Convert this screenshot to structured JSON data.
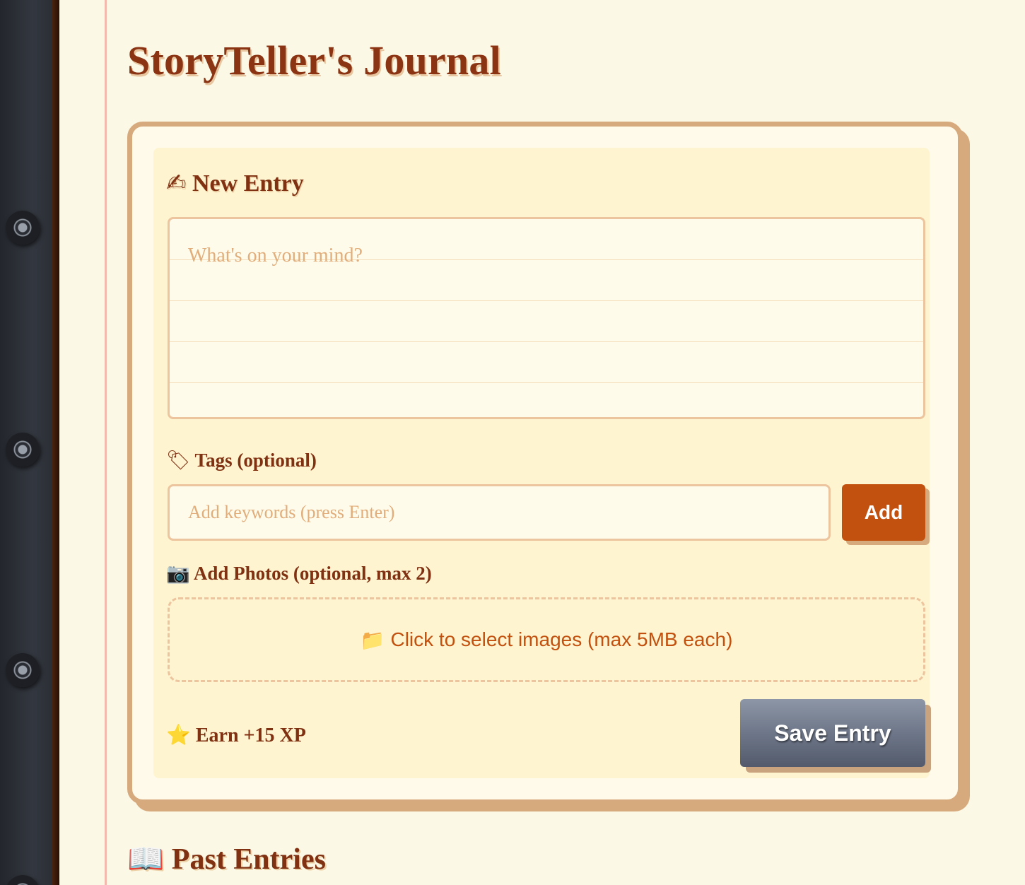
{
  "app": {
    "title": "StoryTeller's Journal"
  },
  "new_entry": {
    "icon": "writing-hand-icon",
    "icon_glyph": "✍",
    "heading": "New Entry",
    "textarea_placeholder": "What's on your mind?",
    "textarea_value": ""
  },
  "tags": {
    "icon": "tag-icon",
    "icon_glyph": "🏷",
    "label": "Tags (optional)",
    "input_placeholder": "Add keywords (press Enter)",
    "input_value": "",
    "add_label": "Add"
  },
  "photos": {
    "icon": "camera-icon",
    "icon_glyph": "📷",
    "label": "Add Photos (optional, max 2)",
    "dropzone_icon": "folder-icon",
    "dropzone_icon_glyph": "📁",
    "dropzone_text": "Click to select images (max 5MB each)"
  },
  "footer": {
    "xp_icon": "star-icon",
    "xp_icon_glyph": "⭐",
    "xp_text": "Earn +15 XP",
    "save_label": "Save Entry"
  },
  "past_entries": {
    "icon": "open-book-icon",
    "icon_glyph": "📖",
    "heading": "Past Entries"
  },
  "colors": {
    "accent": "#c2510f",
    "heading": "#7f3112",
    "card_border": "#d7aa7d",
    "page_background": "#fcf8e6"
  }
}
